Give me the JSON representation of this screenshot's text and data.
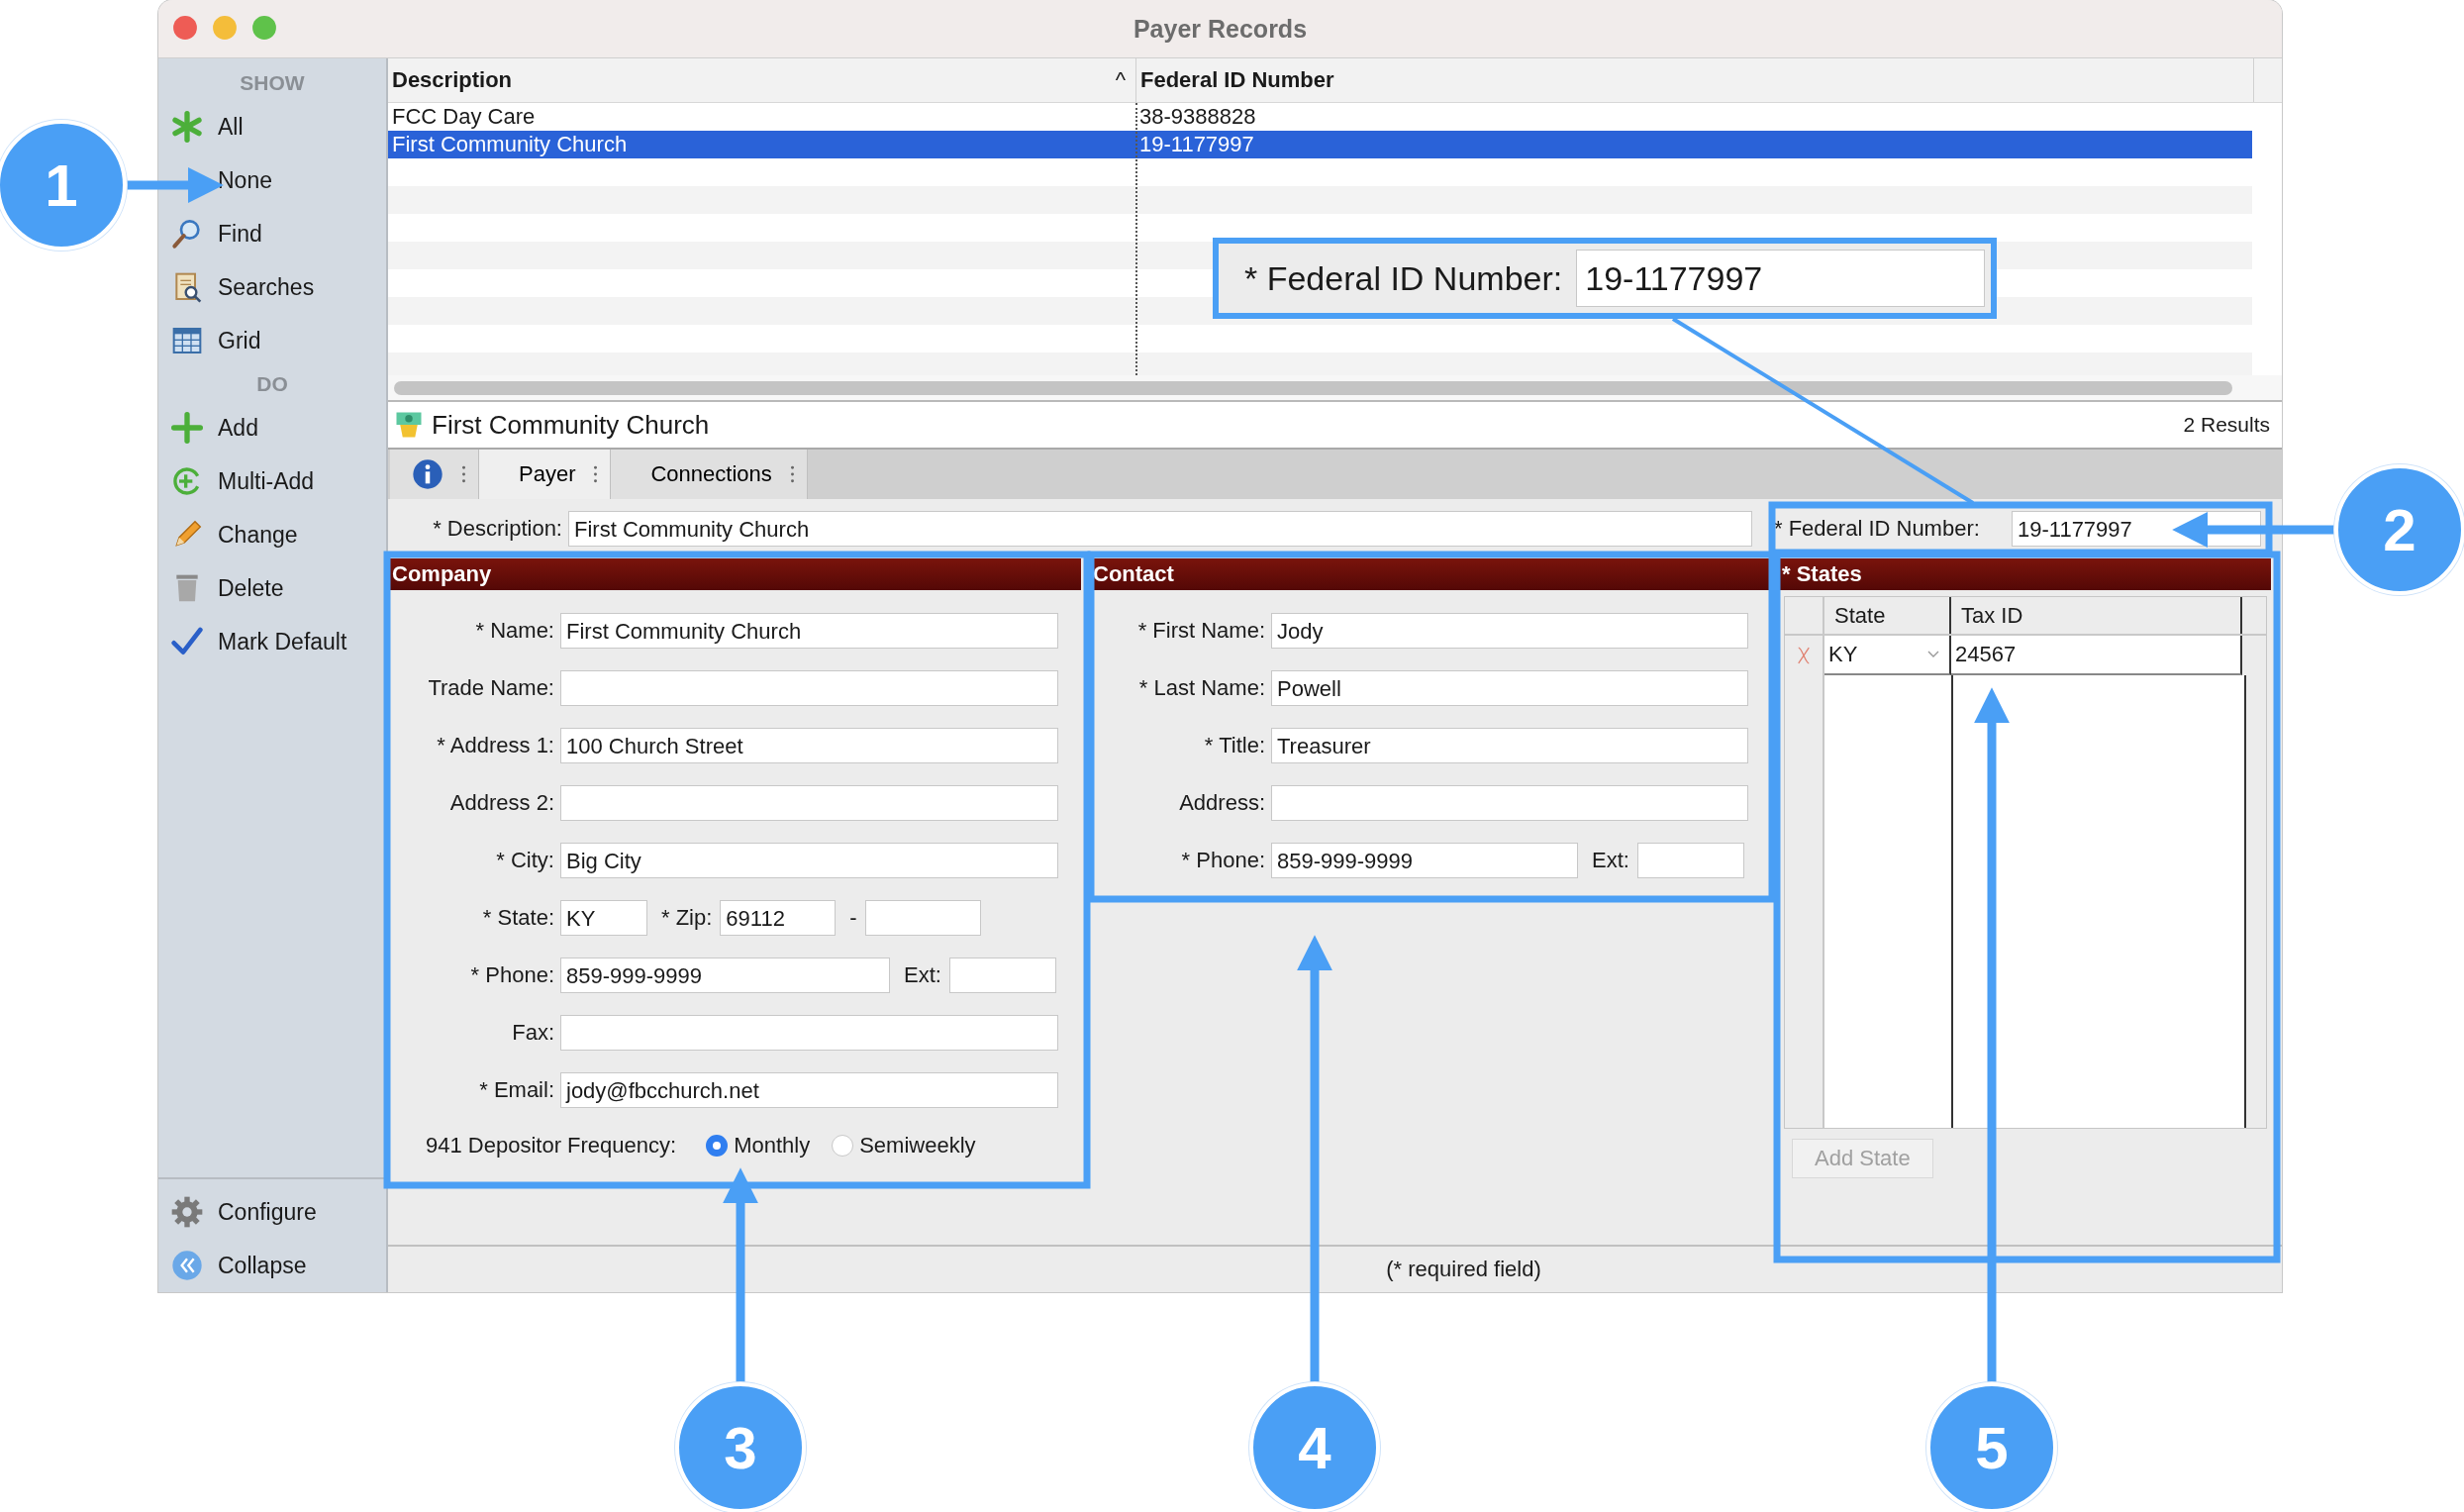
{
  "window": {
    "title": "Payer Records"
  },
  "sidebar": {
    "sections": [
      {
        "heading": "SHOW",
        "items": [
          {
            "label": "All"
          },
          {
            "label": "None"
          },
          {
            "label": "Find"
          },
          {
            "label": "Searches"
          },
          {
            "label": "Grid"
          }
        ]
      },
      {
        "heading": "DO",
        "items": [
          {
            "label": "Add"
          },
          {
            "label": "Multi-Add"
          },
          {
            "label": "Change"
          },
          {
            "label": "Delete"
          },
          {
            "label": "Mark Default"
          }
        ]
      }
    ],
    "footer_items": [
      {
        "label": "Configure"
      },
      {
        "label": "Collapse"
      }
    ]
  },
  "table": {
    "columns": [
      {
        "label": "Description",
        "sort_indicator": "^"
      },
      {
        "label": "Federal ID Number"
      }
    ],
    "rows": [
      {
        "cells": [
          "FCC Day Care",
          "38-9388828"
        ],
        "selected": false
      },
      {
        "cells": [
          "First Community Church",
          "19-1177997"
        ],
        "selected": true
      }
    ]
  },
  "record": {
    "title": "First Community Church",
    "result_count": "2 Results"
  },
  "tabs": [
    {
      "kind": "info",
      "selected": false
    },
    {
      "kind": "text",
      "label": "Payer",
      "selected": true
    },
    {
      "kind": "text",
      "label": "Connections",
      "selected": false
    }
  ],
  "description_field": {
    "label": "* Description:",
    "value": "First Community Church"
  },
  "federal_id_field": {
    "label": "* Federal ID Number:",
    "value": "19-1177997"
  },
  "company": {
    "title": "Company",
    "rows": [
      [
        {
          "label": "* Name:",
          "value": "First Community Church",
          "kind": "full"
        }
      ],
      [
        {
          "label": "Trade Name:",
          "kind": "full"
        }
      ],
      [
        {
          "label": "* Address 1:",
          "value": "100 Church Street",
          "kind": "full"
        }
      ],
      [
        {
          "label": "Address 2:",
          "kind": "full"
        }
      ],
      [
        {
          "label": "* City:",
          "value": "Big City",
          "kind": "full"
        }
      ],
      [
        {
          "label": "* State:",
          "value": "KY",
          "kind": "tiny"
        },
        {
          "label": "* Zip:",
          "value": "69112",
          "kind": "short"
        },
        {
          "label": "-",
          "kind": "short"
        }
      ],
      [
        {
          "label": "* Phone:",
          "value": "859-999-9999",
          "kind": "medium"
        },
        {
          "label": "Ext:",
          "kind": "ext"
        }
      ],
      [
        {
          "label": "Fax:",
          "kind": "full"
        }
      ],
      [
        {
          "label": "* Email:",
          "value": "jody@fbcchurch.net",
          "kind": "full"
        }
      ]
    ],
    "frequency": {
      "label": "941 Depositor Frequency:",
      "options": [
        {
          "label": "Monthly",
          "selected": true
        },
        {
          "label": "Semiweekly",
          "selected": false
        }
      ]
    }
  },
  "contact": {
    "title": "Contact",
    "rows": [
      [
        {
          "label": "* First Name:",
          "value": "Jody",
          "kind": "full"
        }
      ],
      [
        {
          "label": "* Last Name:",
          "value": "Powell",
          "kind": "full"
        }
      ],
      [
        {
          "label": "* Title:",
          "value": "Treasurer",
          "kind": "full"
        }
      ],
      [
        {
          "label": "Address:",
          "kind": "full"
        }
      ],
      [
        {
          "label": "* Phone:",
          "value": "859-999-9999",
          "kind": "medium"
        },
        {
          "label": "Ext:",
          "kind": "ext"
        }
      ]
    ]
  },
  "states": {
    "title": "* States",
    "columns": [
      "State",
      "Tax ID"
    ],
    "rows": [
      {
        "state": "KY",
        "tax_id": "24567"
      }
    ],
    "add_button": {
      "label": "Add State",
      "disabled": true
    }
  },
  "footer": {
    "note": "(* required field)"
  },
  "annotations": {
    "callouts": [
      {
        "number": "1"
      },
      {
        "number": "2"
      },
      {
        "number": "3"
      },
      {
        "number": "4"
      },
      {
        "number": "5"
      }
    ],
    "magnified_field": {
      "label": "* Federal ID Number:",
      "value": "19-1177997"
    }
  }
}
